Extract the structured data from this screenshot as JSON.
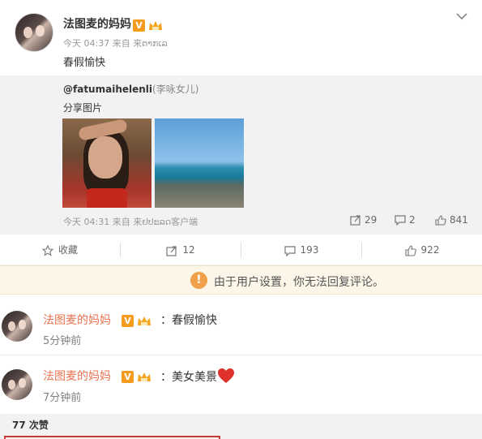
{
  "post": {
    "author": "法图麦的妈妈",
    "verified_badge": "V",
    "time": "今天 04:37 来自 来ຕາກເລ",
    "text": "春假愉快"
  },
  "repost": {
    "user": "@fatumaihelenli",
    "user_note": "(李咏女儿)",
    "share_text": "分享图片",
    "time": "今天 04:31 来自 来ຢປະລດ客户端",
    "reposts": "29",
    "comments": "2",
    "likes": "841"
  },
  "actions": {
    "favorite": "收藏",
    "repost": "12",
    "comment": "193",
    "like": "922"
  },
  "notice": {
    "icon": "!",
    "text": "由于用户设置，你无法回复评论。"
  },
  "comments": [
    {
      "author": "法图麦的妈妈",
      "badge": "V",
      "text": "：春假愉快",
      "time": "5分钟前"
    },
    {
      "author": "法图麦的妈妈",
      "badge": "V",
      "text": "：美女美景",
      "time": "7分钟前"
    }
  ],
  "likes_bar": {
    "count": "77 次赞"
  },
  "colors": {
    "accent": "#eb7350",
    "badge": "#f59b1e",
    "notice_bg": "#fcf6e8",
    "heart": "#e0322a"
  }
}
